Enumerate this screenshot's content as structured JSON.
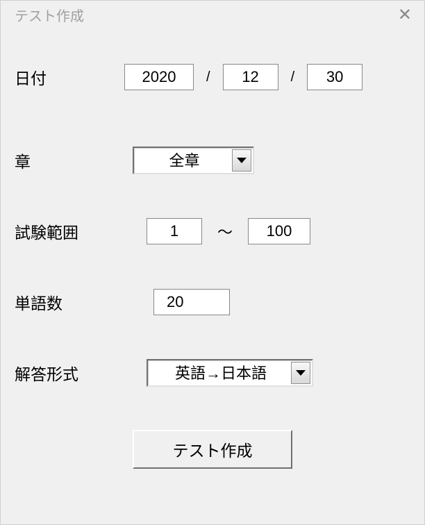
{
  "window": {
    "title": "テスト作成"
  },
  "labels": {
    "date": "日付",
    "chapter": "章",
    "range": "試験範囲",
    "word_count": "単語数",
    "answer_format": "解答形式"
  },
  "date": {
    "year": "2020",
    "month": "12",
    "day": "30",
    "separator": "/"
  },
  "chapter": {
    "selected": "全章"
  },
  "range": {
    "from": "1",
    "to": "100",
    "separator": "～"
  },
  "word_count": {
    "value": "20"
  },
  "answer_format": {
    "selected": "英語→日本語"
  },
  "submit": {
    "label": "テスト作成"
  }
}
